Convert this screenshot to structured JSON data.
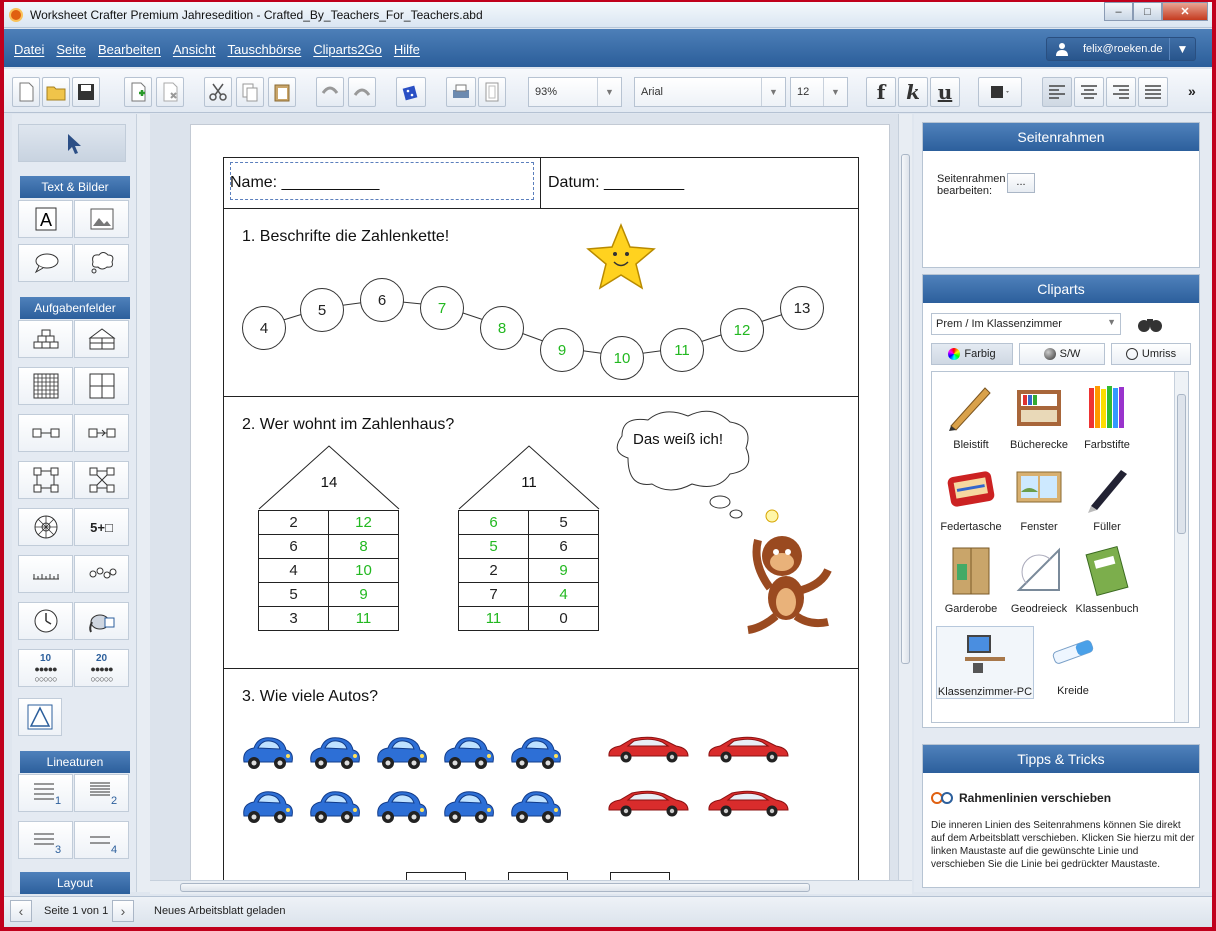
{
  "window": {
    "title": "Worksheet Crafter Premium Jahresedition - Crafted_By_Teachers_For_Teachers.abd",
    "minimize_label": "–",
    "maximize_label": "□",
    "close_label": "✕"
  },
  "menu": {
    "items": [
      "Datei",
      "Seite",
      "Bearbeiten",
      "Ansicht",
      "Tauschbörse",
      "Cliparts2Go",
      "Hilfe"
    ]
  },
  "user": {
    "email": "felix@roeken.de"
  },
  "toolbar": {
    "zoom": "93%",
    "font": "Arial",
    "size": "12",
    "bold_label": "f",
    "italic_label": "k",
    "underline_label": "u",
    "more_label": "»"
  },
  "left_panel": {
    "sections": [
      "Text & Bilder",
      "Aufgabenfelder",
      "Lineaturen",
      "Layout"
    ],
    "tool_5plus": "5+□",
    "count10": "10",
    "count20": "20",
    "lin1": "1",
    "lin2": "2",
    "lin3": "3",
    "lin4": "4"
  },
  "worksheet": {
    "name_label": "Name: ___________",
    "date_label": "Datum: _________",
    "task1_title": "1. Beschrifte die Zahlenkette!",
    "chain": [
      {
        "v": "4",
        "g": false
      },
      {
        "v": "5",
        "g": false
      },
      {
        "v": "6",
        "g": false
      },
      {
        "v": "7",
        "g": true
      },
      {
        "v": "8",
        "g": true
      },
      {
        "v": "9",
        "g": true
      },
      {
        "v": "10",
        "g": true
      },
      {
        "v": "11",
        "g": true
      },
      {
        "v": "12",
        "g": true
      },
      {
        "v": "13",
        "g": false
      }
    ],
    "task2_title": "2. Wer wohnt im Zahlenhaus?",
    "thought_bubble": "Das weiß ich!",
    "house1": {
      "roof": "14",
      "rows": [
        [
          "2",
          "12"
        ],
        [
          "6",
          "8"
        ],
        [
          "4",
          "10"
        ],
        [
          "5",
          "9"
        ],
        [
          "3",
          "11"
        ]
      ]
    },
    "house2": {
      "roof": "11",
      "rows": [
        [
          "6",
          "5"
        ],
        [
          "5",
          "6"
        ],
        [
          "2",
          "9"
        ],
        [
          "7",
          "4"
        ],
        [
          "11",
          "0"
        ]
      ]
    },
    "house1_green_col": 1,
    "house2_green": [
      [
        true,
        false
      ],
      [
        true,
        false
      ],
      [
        false,
        true
      ],
      [
        false,
        true
      ],
      [
        true,
        false
      ]
    ],
    "task3_title": "3. Wie viele Autos?",
    "blue_cars": 10,
    "red_cars": 4
  },
  "right_panel": {
    "frame_title": "Seitenrahmen",
    "frame_label": "Seitenrahmen bearbeiten:",
    "frame_btn": "...",
    "cliparts_title": "Cliparts",
    "category": "Prem / Im Klassenzimmer",
    "filters": [
      "Farbig",
      "S/W",
      "Umriss"
    ],
    "cliparts": [
      "Bleistift",
      "Bücherecke",
      "Farbstifte",
      "Federtasche",
      "Fenster",
      "Füller",
      "Garderobe",
      "Geodreieck",
      "Klassenbuch",
      "Klassenzimmer-PC",
      "Kreide"
    ],
    "tips_title": "Tipps & Tricks",
    "tip_heading": "Rahmenlinien verschieben",
    "tip_text": "Die inneren Linien des Seitenrahmens können Sie direkt auf dem Arbeitsblatt verschieben. Klicken Sie hierzu mit der linken Maustaste auf die gewünschte Linie und verschieben Sie die Linie bei gedrückter Maustaste."
  },
  "status": {
    "page": "Seite 1 von 1",
    "message": "Neues Arbeitsblatt geladen"
  },
  "colors": {
    "accent": "#2c5f9c",
    "answer_green": "#22b820",
    "border_red": "#c0001c"
  }
}
